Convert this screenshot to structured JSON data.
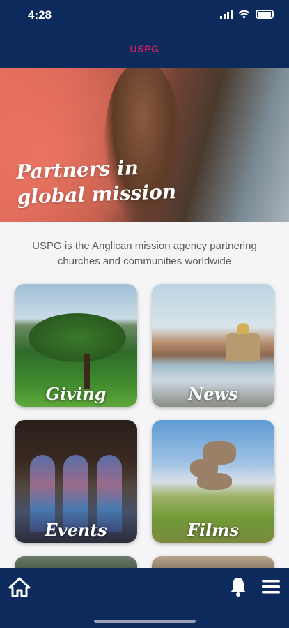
{
  "status_bar": {
    "time": "4:28"
  },
  "header": {
    "title": "USPG"
  },
  "hero": {
    "tagline_line1": "Partners in",
    "tagline_line2": "global mission"
  },
  "intro": {
    "text": "USPG is the Anglican mission agency partnering churches and communities worldwide"
  },
  "tiles": [
    {
      "label": "Giving"
    },
    {
      "label": "News"
    },
    {
      "label": "Events"
    },
    {
      "label": "Films"
    }
  ],
  "colors": {
    "nav_background": "#0d2a5c",
    "brand_title": "#c8215d",
    "page_background": "#f5f5f7"
  },
  "icons": {
    "status": [
      "signal-icon",
      "wifi-icon",
      "battery-icon"
    ],
    "bottom_nav": [
      "home-icon",
      "bell-icon",
      "menu-icon"
    ]
  }
}
